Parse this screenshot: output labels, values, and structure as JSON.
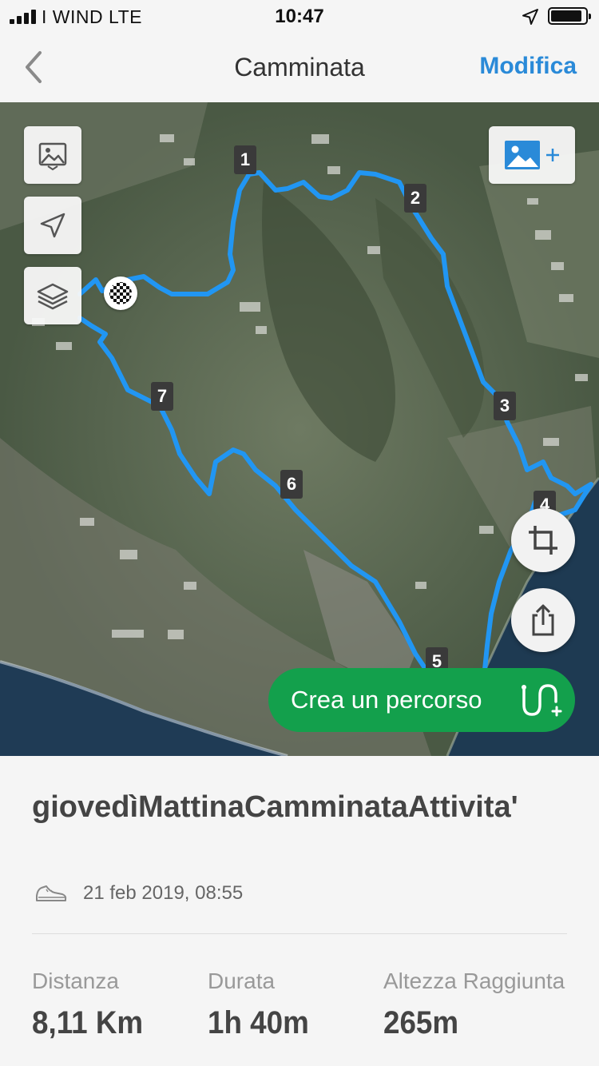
{
  "status_bar": {
    "carrier": "I WIND   LTE",
    "time": "10:47",
    "battery_level": 0.9
  },
  "nav": {
    "title": "Camminata",
    "edit_label": "Modifica",
    "back_icon": "chevron-left-icon"
  },
  "map": {
    "waypoints": [
      "1",
      "2",
      "3",
      "4",
      "5",
      "6",
      "7"
    ],
    "route_color": "#2196f3",
    "sea_color": "#1e3a52",
    "buttons": [
      "photos-icon",
      "navigation-arrow-icon",
      "layers-icon",
      "add-photo-icon",
      "crop-icon",
      "share-icon"
    ],
    "cta_label": "Crea un percorso"
  },
  "activity": {
    "title": "giovedìMattinaCamminataAttivita'",
    "date": "21 feb 2019, 08:55",
    "type_icon": "shoe-icon",
    "stats": [
      {
        "label": "Distanza",
        "value": "8,11 Km"
      },
      {
        "label": "Durata",
        "value": "1h 40m"
      },
      {
        "label": "Altezza Raggiunta",
        "value": "265m"
      }
    ]
  },
  "colors": {
    "accent": "#2a8ad8",
    "cta": "#13a04c",
    "route": "#2196f3"
  }
}
